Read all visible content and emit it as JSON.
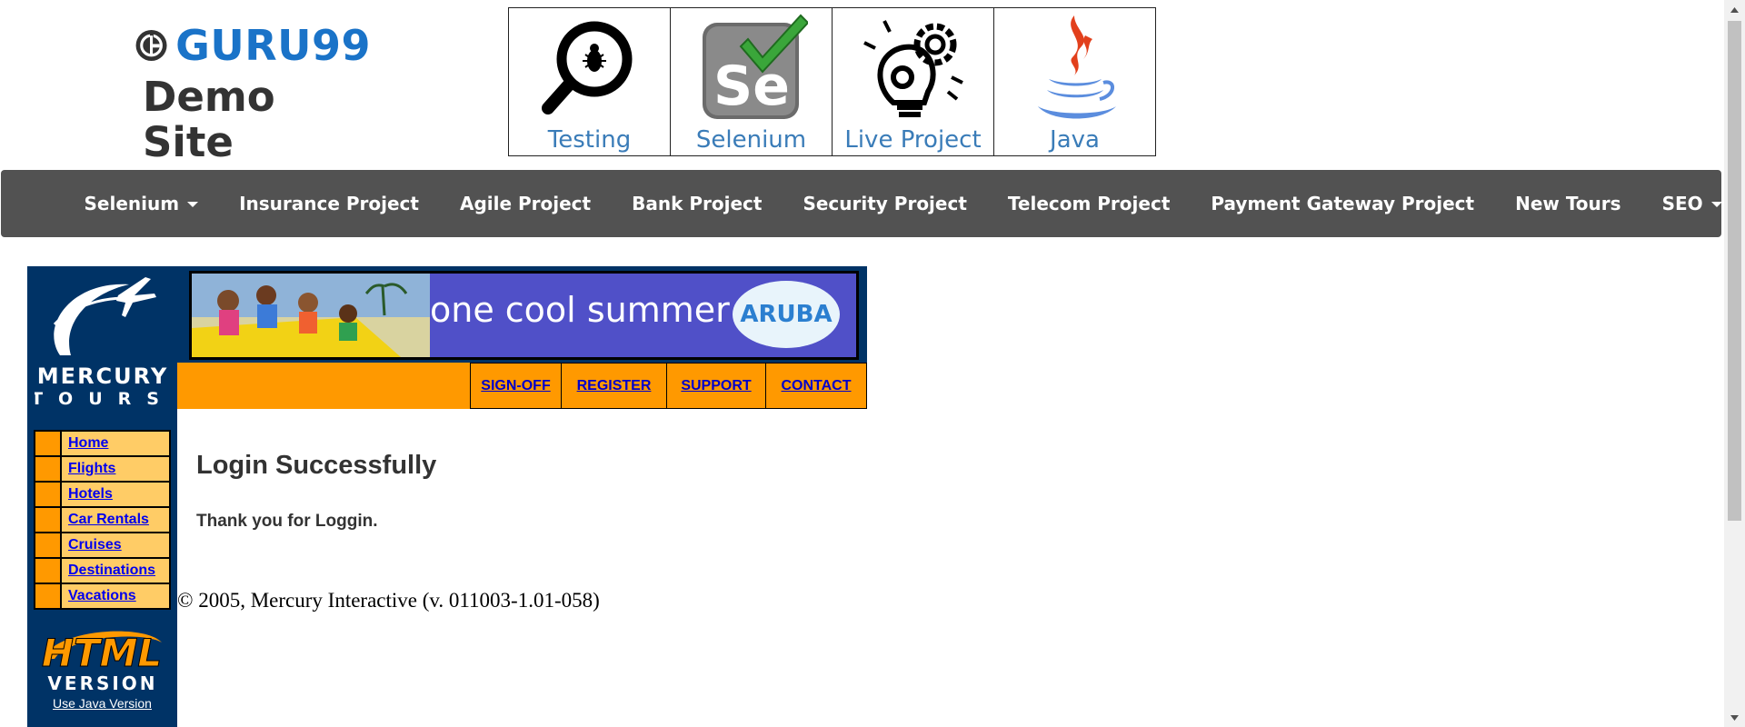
{
  "header": {
    "brand": "GURU99",
    "site_title": "Demo Site",
    "tiles": [
      {
        "label": "Testing",
        "icon": "magnifier-bug-icon"
      },
      {
        "label": "Selenium",
        "icon": "selenium-logo-icon"
      },
      {
        "label": "Live Project",
        "icon": "lightbulb-gears-icon"
      },
      {
        "label": "Java",
        "icon": "java-cup-icon"
      }
    ]
  },
  "nav": {
    "items": [
      {
        "label": "Selenium",
        "dropdown": true
      },
      {
        "label": "Insurance Project"
      },
      {
        "label": "Agile Project"
      },
      {
        "label": "Bank Project"
      },
      {
        "label": "Security Project"
      },
      {
        "label": "Telecom Project"
      },
      {
        "label": "Payment Gateway Project"
      },
      {
        "label": "New Tours"
      },
      {
        "label": "SEO",
        "dropdown": true
      }
    ]
  },
  "mercury": {
    "logo_line1": "MERCURY",
    "logo_line2": "TOURS",
    "menu": [
      "Home",
      "Flights",
      "Hotels",
      "Car Rentals",
      "Cruises",
      "Destinations",
      "Vacations"
    ],
    "html_version_line1": "HTML",
    "html_version_line2": "VERSION",
    "java_link": "Use Java Version",
    "banner_text": "one cool summer",
    "banner_brand": "ARUBA",
    "top_links": [
      "SIGN-OFF",
      "REGISTER",
      "SUPPORT",
      "CONTACT"
    ],
    "success_title": "Login Successfully",
    "success_message": "Thank you for Loggin.",
    "copyright": "© 2005, Mercury Interactive (v. 011003-1.01-058)"
  },
  "colors": {
    "nav_bg": "#525252",
    "mercury_navy": "#003366",
    "mercury_orange": "#ff9900",
    "mercury_menu_yellow": "#ffcc66",
    "guru_blue": "#1a73c8"
  }
}
